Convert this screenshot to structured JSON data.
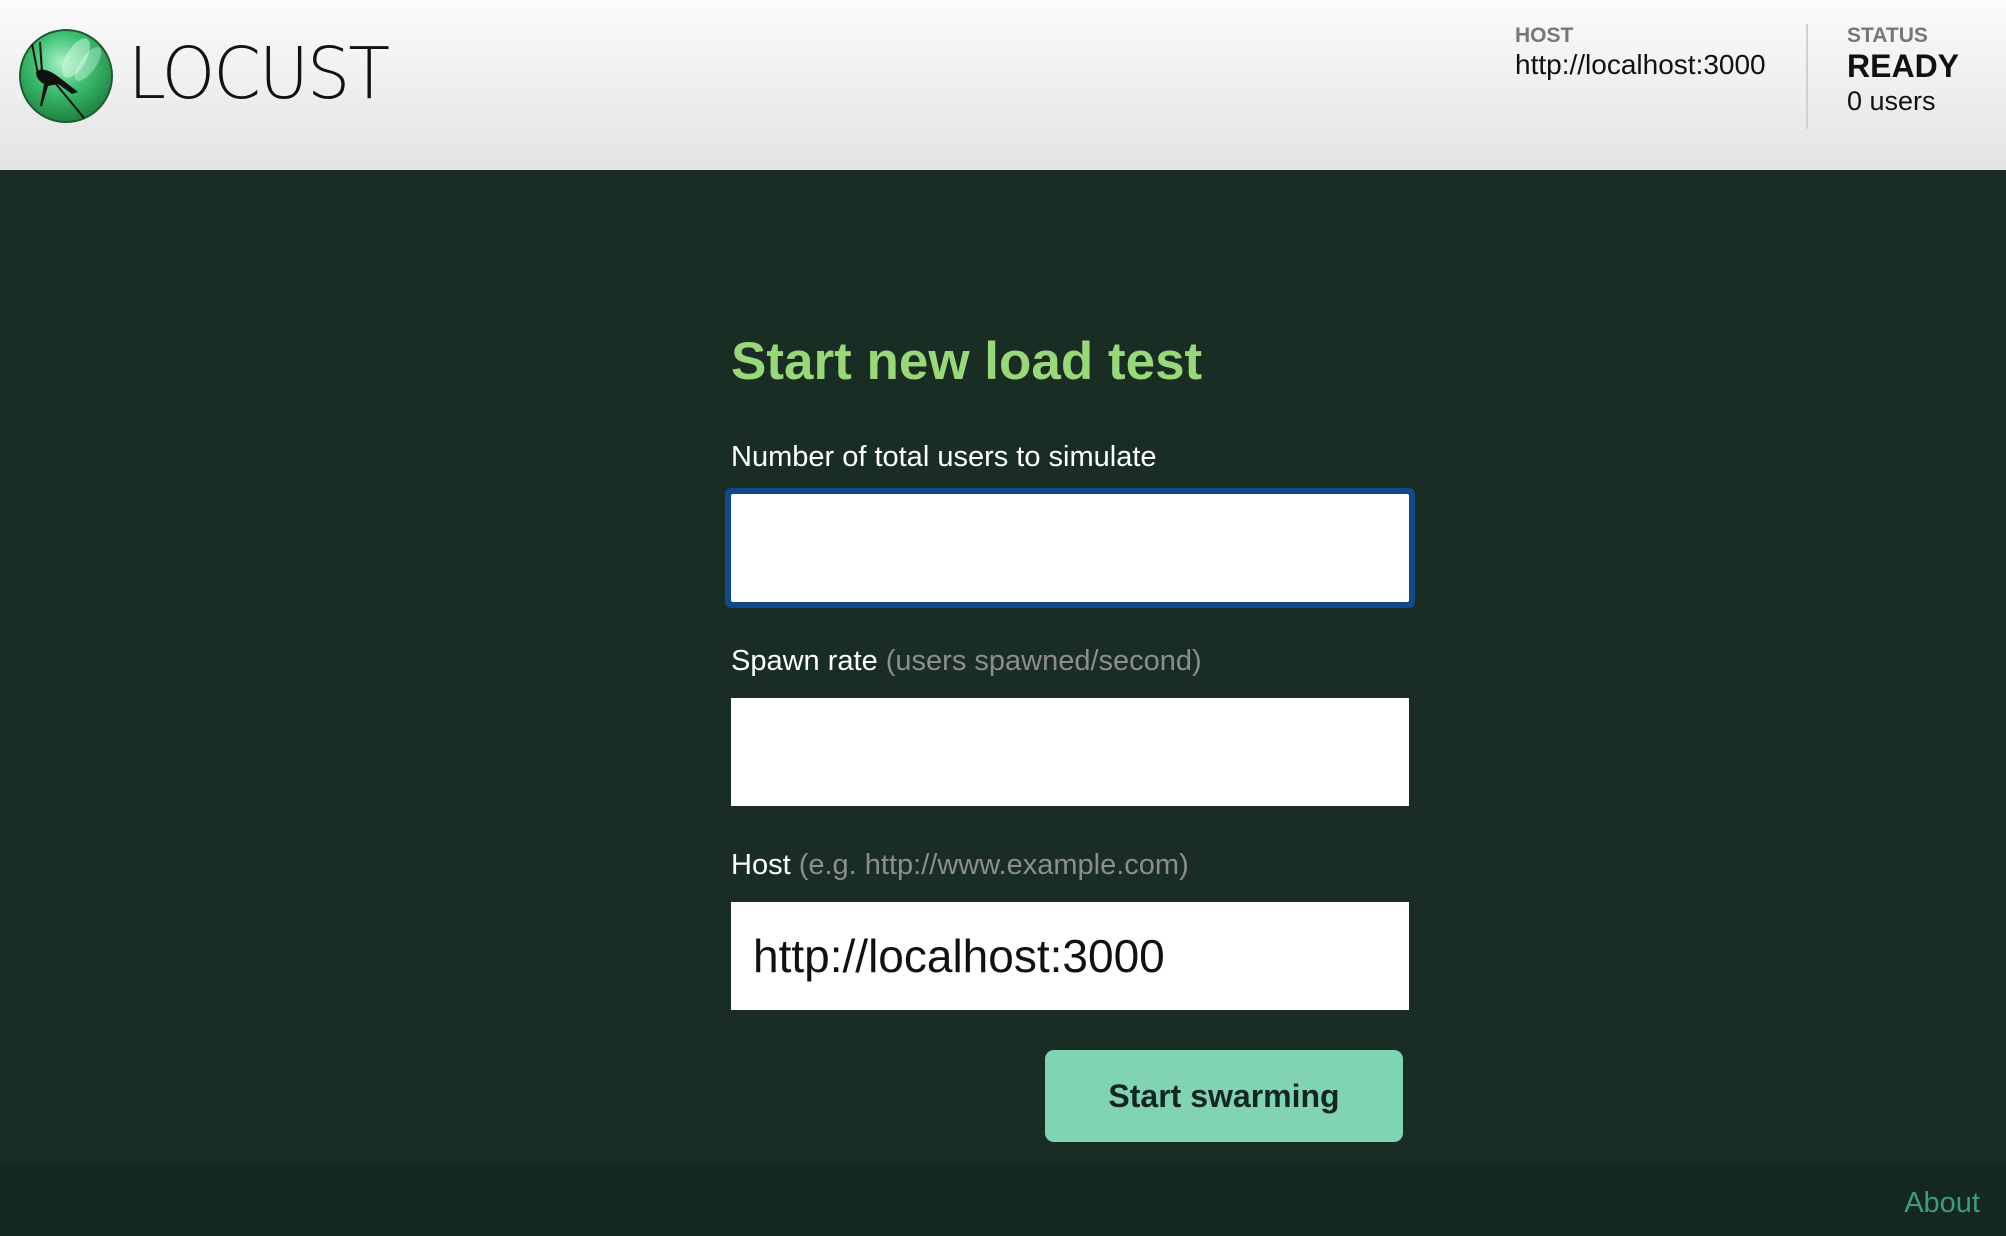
{
  "app": {
    "name": "LOCUST",
    "logo_icon": "locust-logo-icon"
  },
  "header": {
    "host_label": "HOST",
    "host_value": "http://localhost:3000",
    "status_label": "STATUS",
    "status_value": "READY",
    "users_text": "0 users"
  },
  "form": {
    "title": "Start new load test",
    "users_field": {
      "label": "Number of total users to simulate",
      "value": "",
      "placeholder": ""
    },
    "spawn_rate_field": {
      "label": "Spawn rate",
      "hint": "(users spawned/second)",
      "value": "",
      "placeholder": ""
    },
    "host_field": {
      "label": "Host",
      "hint": "(e.g. http://www.example.com)",
      "value": "http://localhost:3000",
      "placeholder": ""
    },
    "submit_label": "Start swarming"
  },
  "footer": {
    "about_label": "About"
  },
  "colors": {
    "background": "#192d25",
    "title": "#98d878",
    "button": "#80d4b3",
    "focus_outline": "#114a8b",
    "link": "#3b9c7e"
  }
}
